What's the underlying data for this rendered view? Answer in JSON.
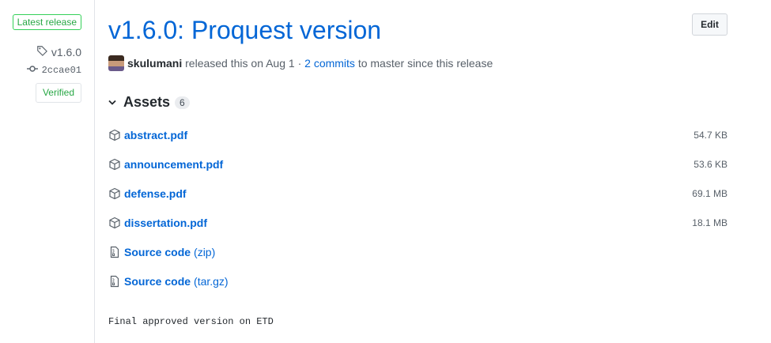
{
  "sidebar": {
    "latest_label": "Latest release",
    "tag": "v1.6.0",
    "commit": "2ccae01",
    "verified_label": "Verified"
  },
  "release": {
    "title": "v1.6.0: Proquest version",
    "edit_label": "Edit",
    "author": "skulumani",
    "released_text": "released this on Aug 1",
    "separator": "·",
    "commits_link": "2 commits",
    "commits_suffix": "to master since this release"
  },
  "assets": {
    "heading": "Assets",
    "count": "6",
    "items": [
      {
        "name": "abstract.pdf",
        "size": "54.7 KB",
        "icon": "package-icon"
      },
      {
        "name": "announcement.pdf",
        "size": "53.6 KB",
        "icon": "package-icon"
      },
      {
        "name": "defense.pdf",
        "size": "69.1 MB",
        "icon": "package-icon"
      },
      {
        "name": "dissertation.pdf",
        "size": "18.1 MB",
        "icon": "package-icon"
      },
      {
        "name": "Source code",
        "ext": "(zip)",
        "icon": "file-zip-icon"
      },
      {
        "name": "Source code",
        "ext": "(tar.gz)",
        "icon": "file-zip-icon"
      }
    ]
  },
  "notes": "Final approved version on ETD",
  "colors": {
    "link": "#0366d6",
    "verified": "#28a745",
    "divider": "#e1e4e8"
  }
}
